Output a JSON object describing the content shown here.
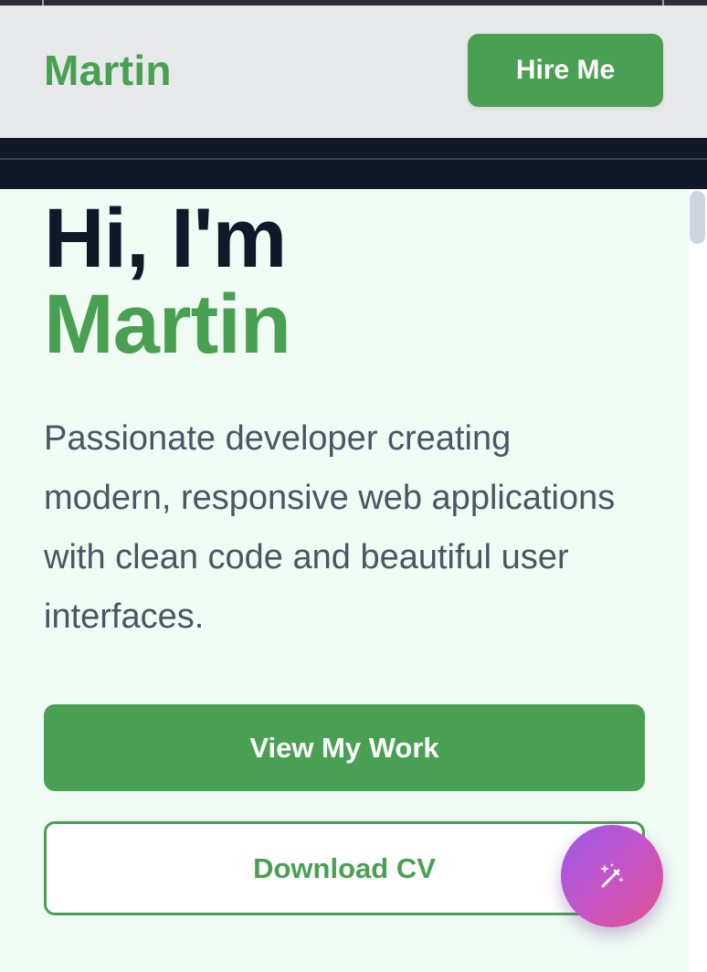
{
  "header": {
    "logo": "Martin",
    "hire_button": "Hire Me"
  },
  "hero": {
    "greeting": "Hi, I'm",
    "name": "Martin",
    "tagline": "Passionate developer creating modern, responsive web applications with clean code and beautiful user interfaces.",
    "primary_button": "View My Work",
    "secondary_button": "Download CV"
  },
  "floating_action": {
    "icon": "magic-wand-icon"
  },
  "colors": {
    "accent": "#4aa052",
    "heading": "#111827",
    "body_text": "#4b5563",
    "hero_background": "#f0fbf4",
    "header_background": "#e7e8ea",
    "fab_gradient_start": "#9b59e8",
    "fab_gradient_end": "#e2508f"
  }
}
